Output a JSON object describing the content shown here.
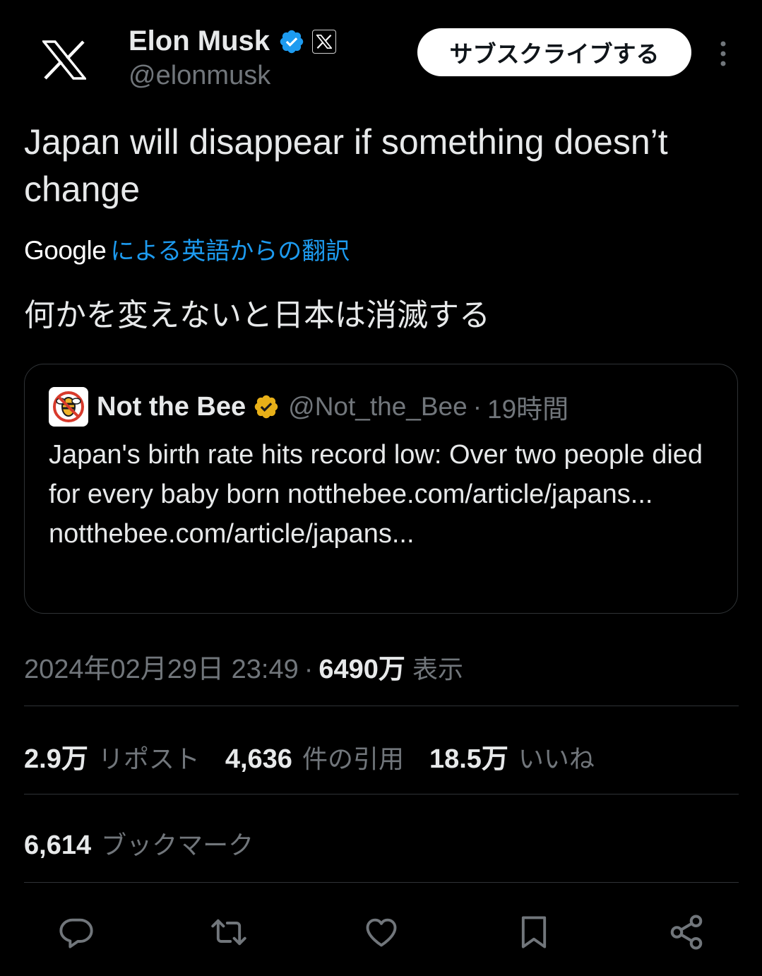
{
  "author": {
    "display_name": "Elon Musk",
    "handle": "@elonmusk",
    "verified_icon": "verified-badge-icon",
    "affiliation_icon": "x-logo-badge-icon",
    "verified_color": "#1d9bf0"
  },
  "header": {
    "subscribe_label": "サブスクライブする",
    "more_icon": "more-vertical-icon"
  },
  "tweet": {
    "text": "Japan will disappear if something doesn’t change",
    "translation_brand": "Google",
    "translation_label": "による英語からの翻訳",
    "translated_text": "何かを変えないと日本は消滅する"
  },
  "quote": {
    "display_name": "Not the Bee",
    "handle": "@Not_the_Bee",
    "separator": "·",
    "time": "19時間",
    "verified_color": "#e8b018",
    "text": "Japan's birth rate hits record low: Over two people died for every baby born notthebee.com/article/japans... notthebee.com/article/japans..."
  },
  "meta": {
    "date": "2024年02月29日 23:49",
    "separator": "·",
    "views_count": "6490万",
    "views_label": "表示"
  },
  "stats": {
    "reposts_count": "2.9万",
    "reposts_label": "リポスト",
    "quotes_count": "4,636",
    "quotes_label": "件の引用",
    "likes_count": "18.5万",
    "likes_label": "いいね",
    "bookmarks_count": "6,614",
    "bookmarks_label": "ブックマーク"
  },
  "actions": [
    "reply-icon",
    "repost-icon",
    "like-icon",
    "bookmark-icon",
    "share-icon"
  ],
  "colors": {
    "background": "#000000",
    "text_primary": "#e7e9ea",
    "text_secondary": "#71767b",
    "link": "#1d9bf0",
    "border": "#2f3336"
  }
}
